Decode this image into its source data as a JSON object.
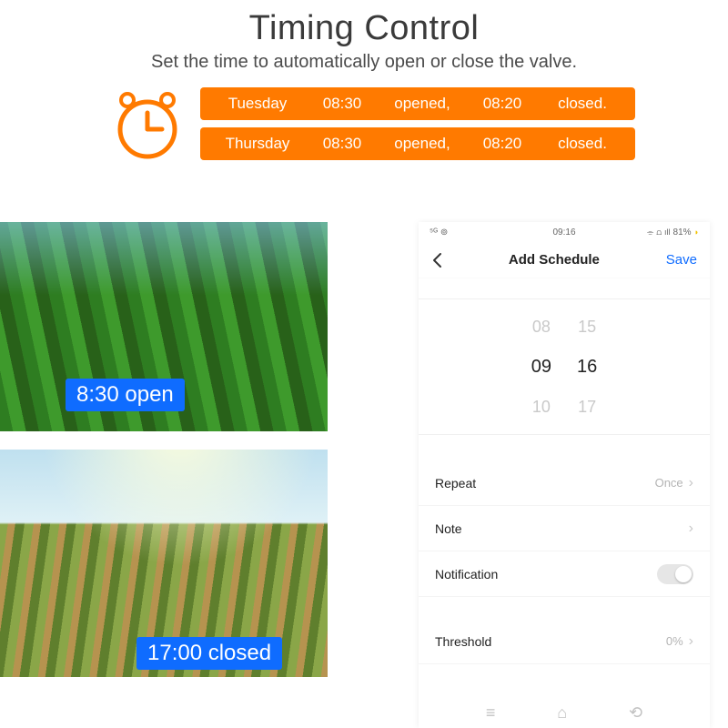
{
  "header": {
    "title": "Timing Control",
    "subtitle": "Set the time to automatically open or close the valve."
  },
  "schedules": [
    {
      "day": "Tuesday",
      "open_time": "08:30",
      "open_word": "opened,",
      "close_time": "08:20",
      "close_word": "closed."
    },
    {
      "day": "Thursday",
      "open_time": "08:30",
      "open_word": "opened,",
      "close_time": "08:20",
      "close_word": "closed."
    }
  ],
  "photos": {
    "caption_open": "8:30 open",
    "caption_close": "17:00 closed"
  },
  "phone": {
    "status": {
      "time": "09:16",
      "carrier": "⁵ᴳ ⊚",
      "battery": "81%"
    },
    "nav": {
      "title": "Add Schedule",
      "save": "Save"
    },
    "picker": {
      "hours": [
        "08",
        "09",
        "10"
      ],
      "minutes": [
        "15",
        "16",
        "17"
      ],
      "selected_index": 1
    },
    "settings": [
      {
        "label": "Repeat",
        "value": "Once",
        "has_chevron": true,
        "toggle": false
      },
      {
        "label": "Note",
        "value": "",
        "has_chevron": true,
        "toggle": false
      },
      {
        "label": "Notification",
        "value": "",
        "has_chevron": false,
        "toggle": true
      }
    ],
    "settings2": [
      {
        "label": "Threshold",
        "value": "0%",
        "has_chevron": true,
        "toggle": false
      }
    ]
  }
}
